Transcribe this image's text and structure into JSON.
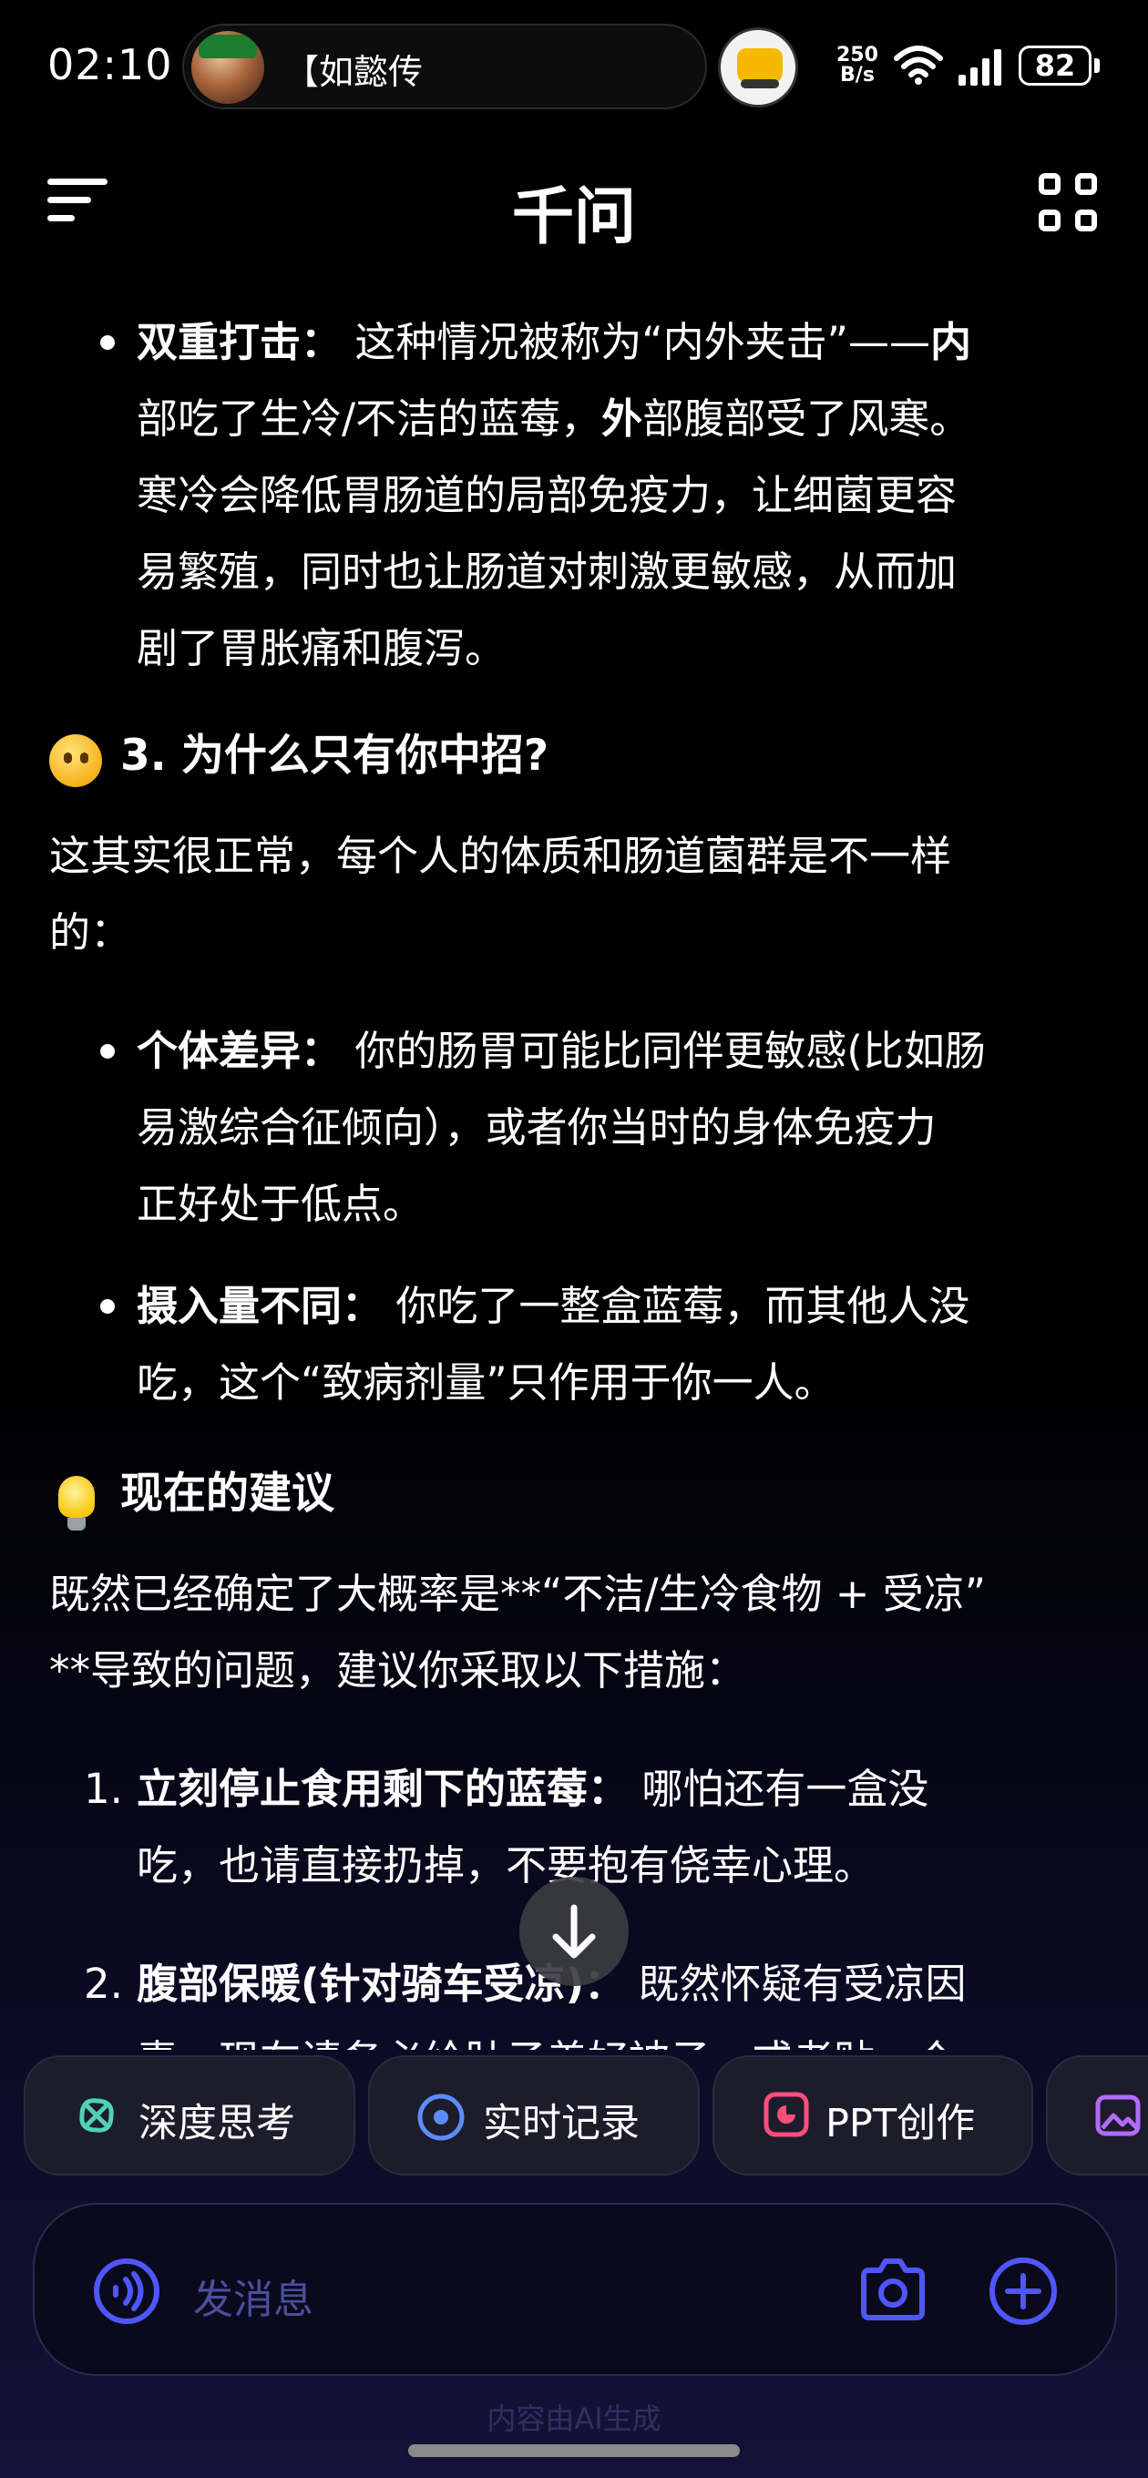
{
  "status_bar": {
    "time": "02:10",
    "live_activity_text": "【如懿传",
    "net_speed_value": "250",
    "net_speed_unit": "B/s",
    "battery": "82",
    "icons": [
      "live-avatar-icon",
      "delivery-scooter-icon",
      "wifi-icon",
      "signal-icon",
      "battery-icon"
    ]
  },
  "header": {
    "title": "千问",
    "icons": [
      "menu-icon",
      "grid-apps-icon"
    ]
  },
  "content": {
    "bullet1": {
      "lead": "双重打击：",
      "line1_mid": " 这种情况被称为“内外夹击”——",
      "line1_bold_tail": "内",
      "line2_a": "部吃了生冷/不洁的蓝莓，",
      "line2_bold": "外",
      "line2_b": "部腹部受了风寒。",
      "line3": "寒冷会降低胃肠道的局部免疫力，让细菌更容",
      "line4": "易繁殖，同时也让肠道对刺激更敏感，从而加",
      "line5": "剧了胃胀痛和腹泻。"
    },
    "section3": {
      "emoji": "thinking-face-icon",
      "title": "3. 为什么只有你中招?"
    },
    "para1_line1": "这其实很正常，每个人的体质和肠道菌群是不一样",
    "para1_line2": "的：",
    "bullet2": {
      "lead": "个体差异：",
      "line1_rest": " 你的肠胃可能比同伴更敏感(比如肠",
      "line2": "易激综合征倾向），或者你当时的身体免疫力",
      "line3": "正好处于低点。"
    },
    "bullet3": {
      "lead": "摄入量不同：",
      "line1_rest": " 你吃了一整盒蓝莓，而其他人没",
      "line2": "吃，这个“致病剂量”只作用于你一人。"
    },
    "section_advice": {
      "emoji": "light-bulb-icon",
      "title": "现在的建议"
    },
    "para2_line1": "既然已经确定了大概率是**“不洁/生冷食物 + 受凉”",
    "para2_line2": "**导致的问题，建议你采取以下措施：",
    "ordered": [
      {
        "num": "1.",
        "lead": "立刻停止食用剩下的蓝莓：",
        "line1_rest": " 哪怕还有一盒没",
        "line2": "吃，也请直接扔掉，不要抱有侥幸心理。"
      },
      {
        "num": "2.",
        "lead": "腹部保暖(针对骑车受凉)：",
        "line1_rest": " 既然怀疑有受凉因",
        "line2": "素，现在请务必给肚子盖好被子，或者贴一个"
      }
    ]
  },
  "quick_actions": [
    {
      "label": "深度思考",
      "icon": "deep-think-icon",
      "color": "#4fd2b8"
    },
    {
      "label": "实时记录",
      "icon": "record-icon",
      "color": "#5b8cff"
    },
    {
      "label": "PPT创作",
      "icon": "ppt-icon",
      "color": "#ff4d7a"
    },
    {
      "label": "",
      "icon": "image-icon",
      "color": "#b26bff"
    }
  ],
  "composer": {
    "placeholder": "发消息",
    "icons": [
      "voice-icon",
      "camera-icon",
      "add-icon"
    ],
    "accent": "#4f56ff"
  },
  "footnote": "内容由AI生成"
}
